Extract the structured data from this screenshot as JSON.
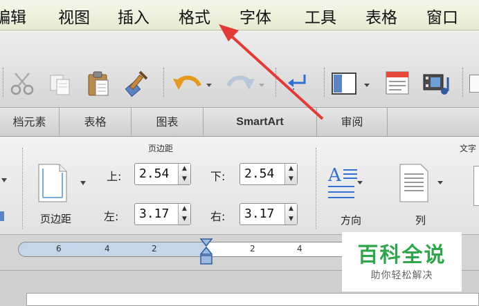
{
  "menu": {
    "items": [
      "编辑",
      "视图",
      "插入",
      "格式",
      "字体",
      "工具",
      "表格",
      "窗口"
    ]
  },
  "ribbon_tabs": [
    "档元素",
    "表格",
    "图表",
    "SmartArt",
    "审阅"
  ],
  "margins_group": {
    "title": "页边距",
    "top_label": "上:",
    "top_value": "2.54",
    "bottom_label": "下:",
    "bottom_value": "2.54",
    "left_label": "左:",
    "left_value": "3.17",
    "right_label": "右:",
    "right_value": "3.17",
    "button_label": "页边距"
  },
  "text_group": {
    "title": "文字",
    "direction_label": "方向",
    "columns_label": "列"
  },
  "ruler": {
    "labels": [
      "6",
      "4",
      "2",
      "2",
      "4"
    ]
  },
  "watermark": {
    "title": "百科全说",
    "subtitle": "助你轻松解决"
  },
  "colors": {
    "arrow": "#e53935",
    "watermark_green": "#2fa64a",
    "ruler_blue": "#c5d6ea"
  }
}
